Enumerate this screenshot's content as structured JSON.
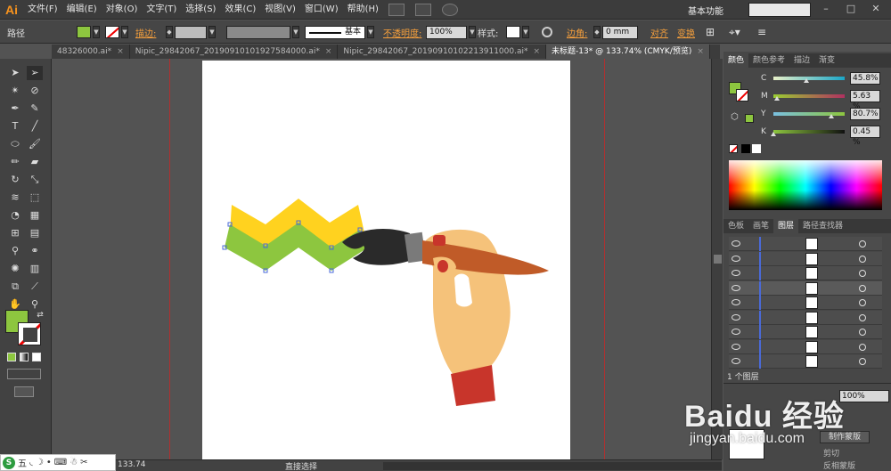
{
  "app": {
    "logo": "Ai",
    "workspace": "基本功能"
  },
  "menu": [
    "文件(F)",
    "编辑(E)",
    "对象(O)",
    "文字(T)",
    "选择(S)",
    "效果(C)",
    "视图(V)",
    "窗口(W)",
    "帮助(H)"
  ],
  "control_bar": {
    "selection_label": "路径",
    "stroke_label": "描边:",
    "stroke_style": "基本",
    "opacity_label": "不透明度:",
    "opacity_value": "100%",
    "style_label": "样式:",
    "corner_label": "边角:",
    "corner_value": "0 mm",
    "align_label": "对齐",
    "transform_label": "变换",
    "fill_color": "#8dc63f"
  },
  "tabs": [
    {
      "label": "48326000.ai*",
      "active": false
    },
    {
      "label": "Nipic_29842067_20190910101927584000.ai*",
      "active": false
    },
    {
      "label": "Nipic_29842067_20190910102213911000.ai*",
      "active": false
    },
    {
      "label": "未标题-13* @ 133.74% (CMYK/预览)",
      "active": true
    }
  ],
  "color_panel": {
    "tabs": [
      "颜色",
      "颜色参考",
      "描边",
      "渐变"
    ],
    "channels": [
      {
        "label": "C",
        "value": "45.8%",
        "fraction": 0.458
      },
      {
        "label": "M",
        "value": "5.63 %",
        "fraction": 0.056
      },
      {
        "label": "Y",
        "value": "80.7%",
        "fraction": 0.807
      },
      {
        "label": "K",
        "value": "0.45 %",
        "fraction": 0.005
      }
    ]
  },
  "layers_panel": {
    "tabs": [
      "色板",
      "画笔",
      "图层",
      "路径查找器"
    ],
    "count_label": "1 个图层",
    "row_count": 9,
    "selected_row": 3
  },
  "status": {
    "zoom": "133.74",
    "tool": "直接选择"
  },
  "ime": {
    "label": "五"
  },
  "watermark": {
    "brand": "Baidu 经验",
    "url": "jingyan.baidu.com"
  },
  "lower_panel": {
    "btn1": "制作蒙版",
    "check1": "剪切",
    "check2": "反相蒙版",
    "percent": "100%"
  },
  "colors": {
    "green": "#8dc63f",
    "yellow": "#ffd21f",
    "skin": "#f5c27a",
    "sleeve": "#c8352b",
    "handle": "#c05b28",
    "bristle": "#2a2a2a"
  }
}
